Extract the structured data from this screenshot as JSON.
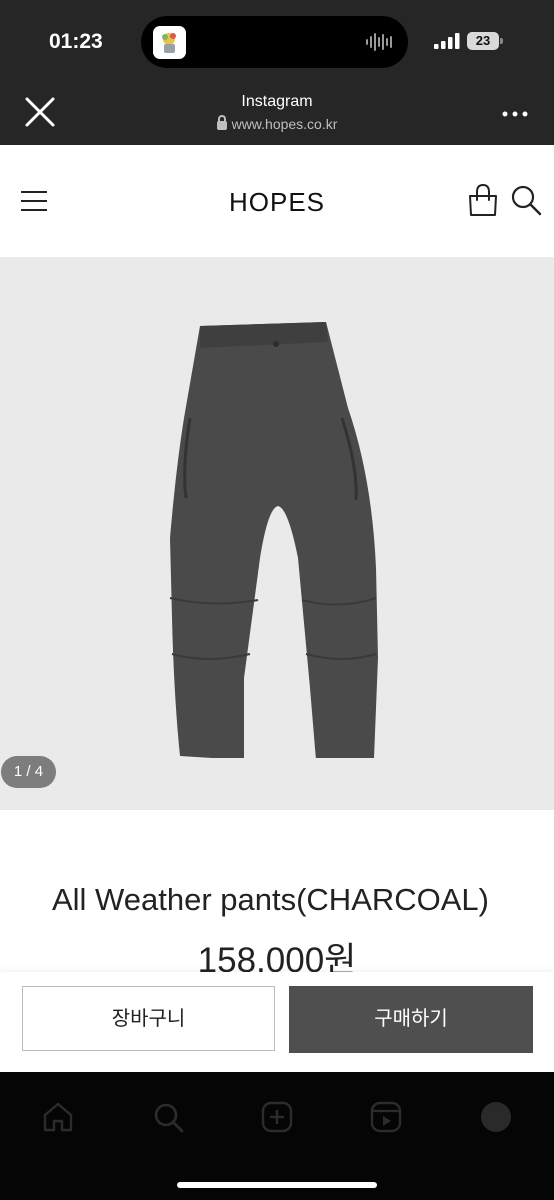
{
  "status_bar": {
    "time": "01:23",
    "battery": "23"
  },
  "browser_nav": {
    "title": "Instagram",
    "url": "www.hopes.co.kr"
  },
  "header": {
    "logo": "HOPES"
  },
  "gallery": {
    "counter": "1 / 4"
  },
  "product": {
    "name": "All Weather pants(CHARCOAL)",
    "price": "158,000원"
  },
  "actions": {
    "cart_label": "장바구니",
    "buy_label": "구매하기"
  },
  "colors": {
    "nav_bg": "#262626",
    "buy_button": "#4f4f4f",
    "image_bg": "#eaeaea",
    "pants": "#4a4a4a"
  },
  "icons": [
    "close-icon",
    "lock-icon",
    "more-icon",
    "menu-icon",
    "bag-icon",
    "search-icon",
    "home-icon",
    "explore-icon",
    "create-icon",
    "reels-icon",
    "profile-icon"
  ]
}
